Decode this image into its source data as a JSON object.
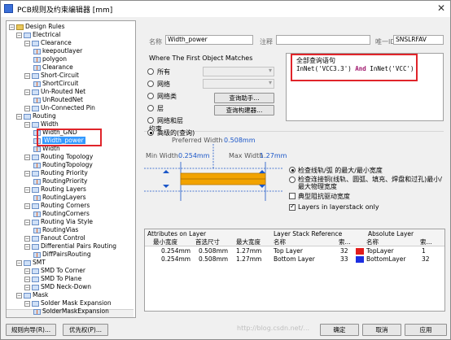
{
  "window": {
    "title": "PCB规则及约束编辑器 [mm]",
    "close_glyph": "✕"
  },
  "tree": {
    "items": [
      {
        "label": "Design Rules",
        "level": 0,
        "kind": "folder"
      },
      {
        "label": "Electrical",
        "level": 1,
        "kind": "group"
      },
      {
        "label": "Clearance",
        "level": 2,
        "kind": "group"
      },
      {
        "label": "keepoutlayer",
        "level": 3,
        "kind": "rule"
      },
      {
        "label": "polygon",
        "level": 3,
        "kind": "rule"
      },
      {
        "label": "Clearance",
        "level": 3,
        "kind": "rule"
      },
      {
        "label": "Short-Circuit",
        "level": 2,
        "kind": "group"
      },
      {
        "label": "ShortCircuit",
        "level": 3,
        "kind": "rule"
      },
      {
        "label": "Un-Routed Net",
        "level": 2,
        "kind": "group"
      },
      {
        "label": "UnRoutedNet",
        "level": 3,
        "kind": "rule"
      },
      {
        "label": "Un-Connected Pin",
        "level": 2,
        "kind": "group"
      },
      {
        "label": "Routing",
        "level": 1,
        "kind": "group"
      },
      {
        "label": "Width",
        "level": 2,
        "kind": "group"
      },
      {
        "label": "Width_GND",
        "level": 3,
        "kind": "rule"
      },
      {
        "label": "Width_power",
        "level": 3,
        "kind": "rule",
        "selected": true
      },
      {
        "label": "Width",
        "level": 3,
        "kind": "rule"
      },
      {
        "label": "Routing Topology",
        "level": 2,
        "kind": "group"
      },
      {
        "label": "RoutingTopology",
        "level": 3,
        "kind": "rule"
      },
      {
        "label": "Routing Priority",
        "level": 2,
        "kind": "group"
      },
      {
        "label": "RoutingPriority",
        "level": 3,
        "kind": "rule"
      },
      {
        "label": "Routing Layers",
        "level": 2,
        "kind": "group"
      },
      {
        "label": "RoutingLayers",
        "level": 3,
        "kind": "rule"
      },
      {
        "label": "Routing Corners",
        "level": 2,
        "kind": "group"
      },
      {
        "label": "RoutingCorners",
        "level": 3,
        "kind": "rule"
      },
      {
        "label": "Routing Via Style",
        "level": 2,
        "kind": "group"
      },
      {
        "label": "RoutingVias",
        "level": 3,
        "kind": "rule"
      },
      {
        "label": "Fanout Control",
        "level": 2,
        "kind": "group"
      },
      {
        "label": "Differential Pairs Routing",
        "level": 2,
        "kind": "group"
      },
      {
        "label": "DiffPairsRouting",
        "level": 3,
        "kind": "rule"
      },
      {
        "label": "SMT",
        "level": 1,
        "kind": "group"
      },
      {
        "label": "SMD To Corner",
        "level": 2,
        "kind": "group"
      },
      {
        "label": "SMD To Plane",
        "level": 2,
        "kind": "group"
      },
      {
        "label": "SMD Neck-Down",
        "level": 2,
        "kind": "group"
      },
      {
        "label": "Mask",
        "level": 1,
        "kind": "group"
      },
      {
        "label": "Solder Mask Expansion",
        "level": 2,
        "kind": "group"
      },
      {
        "label": "SolderMaskExpansion",
        "level": 3,
        "kind": "rule"
      }
    ]
  },
  "rule_header": {
    "name_label": "名称",
    "name_value": "Width_power",
    "comment_label": "注释",
    "comment_value": "",
    "uid_label": "唯一ID",
    "uid_value": "SNSLRFAV"
  },
  "where": {
    "title": "Where The First Object Matches",
    "options": [
      "所有",
      "网络",
      "网络类",
      "层",
      "网络和层",
      "高级的(查询)"
    ],
    "selected_index": 5,
    "query_helper": "查询助手...",
    "query_builder": "查询构建器..."
  },
  "query": {
    "title": "全部查询语句",
    "part1": "InNet('VCC3.3') ",
    "keyword": "And",
    "part2": " InNet('VCC')"
  },
  "constraints": {
    "title": "约束",
    "preferred_label": "Preferred Width",
    "preferred_value": "0.508mm",
    "min_label": "Min Width",
    "min_value": "0.254mm",
    "max_label": "Max Width",
    "max_value": "1.27mm",
    "check_option1": "检查线轨/弧 的最大/最小宽度",
    "check_option2": "检查连接铜(线轨、圆弧、填充、焊盘和过孔)最小/最大物理宽度",
    "typical_impedance": "典型阻抗驱动宽度",
    "layers_in_stack": "Layers in layerstack only"
  },
  "table": {
    "attr_header": "Attributes on Layer",
    "stack_header": "Layer Stack Reference",
    "abs_header": "Absolute Layer",
    "columns": [
      "最小宽度",
      "首选尺寸",
      "最大宽度",
      "名称",
      "索...",
      "名称",
      "索..."
    ],
    "rows": [
      {
        "min": "0.254mm",
        "pref": "0.508mm",
        "max": "1.27mm",
        "name": "Top Layer",
        "idx": "32",
        "abs_name": "TopLayer",
        "abs_idx": "1",
        "color": "#e11d1d"
      },
      {
        "min": "0.254mm",
        "pref": "0.508mm",
        "max": "1.27mm",
        "name": "Bottom Layer",
        "idx": "33",
        "abs_name": "BottomLayer",
        "abs_idx": "32",
        "color": "#1d2fe1"
      }
    ]
  },
  "bottom": {
    "rule_wizard": "规则向导(R)...",
    "priorities": "优先权(P)...",
    "ok": "确定",
    "cancel": "取消",
    "apply": "应用"
  },
  "watermark": "http://blog.csdn.net/..."
}
